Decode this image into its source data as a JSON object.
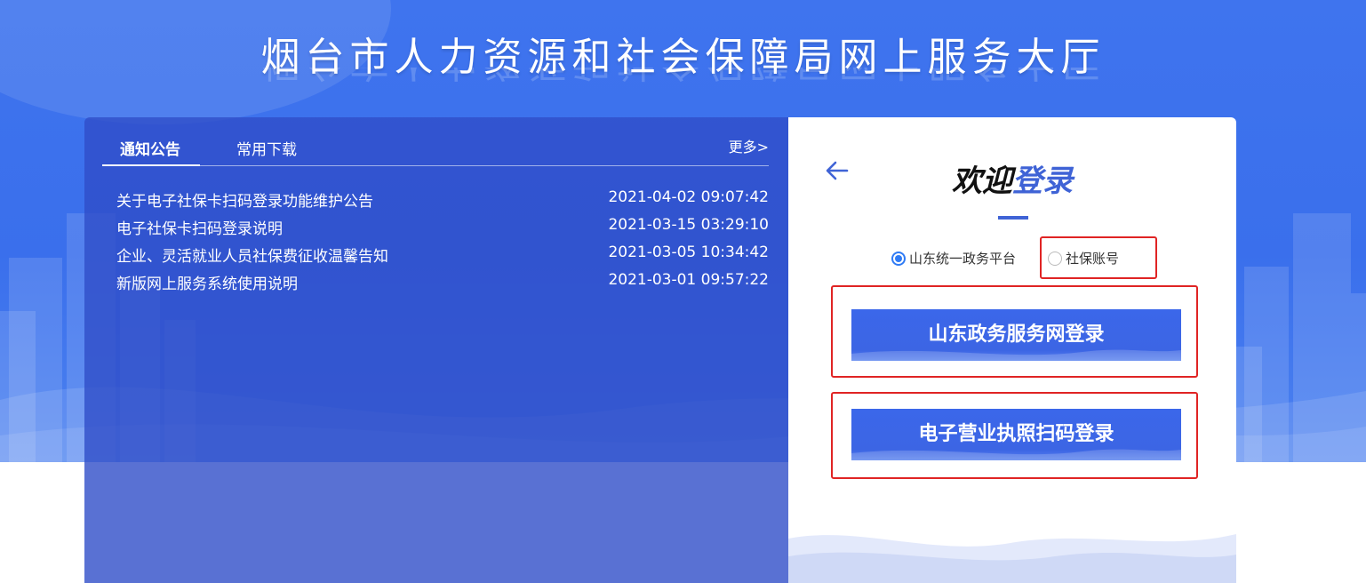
{
  "header": {
    "title": "烟台市人力资源和社会保障局网上服务大厅"
  },
  "notice": {
    "tabs": [
      {
        "label": "通知公告",
        "active": true
      },
      {
        "label": "常用下载",
        "active": false
      }
    ],
    "more_label": "更多>",
    "items": [
      {
        "title": "关于电子社保卡扫码登录功能维护公告",
        "date": "2021-04-02 09:07:42"
      },
      {
        "title": "电子社保卡扫码登录说明",
        "date": "2021-03-15 03:29:10"
      },
      {
        "title": "企业、灵活就业人员社保费征收温馨告知",
        "date": "2021-03-05 10:34:42"
      },
      {
        "title": "新版网上服务系统使用说明",
        "date": "2021-03-01 09:57:22"
      }
    ]
  },
  "login": {
    "welcome_part1": "欢迎",
    "welcome_part2": "登录",
    "radio_options": [
      {
        "label": "山东统一政务平台",
        "selected": true
      },
      {
        "label": "社保账号",
        "selected": false
      }
    ],
    "buttons": [
      {
        "label": "山东政务服务网登录"
      },
      {
        "label": "电子营业执照扫码登录"
      }
    ]
  },
  "colors": {
    "primary_blue": "#3f74ee",
    "panel_blue": "#304ec8",
    "accent": "#3f63d6",
    "highlight_red": "#e02424",
    "radio_selected": "#2f7bf5"
  },
  "icons": {
    "back": "arrow-left-icon"
  }
}
